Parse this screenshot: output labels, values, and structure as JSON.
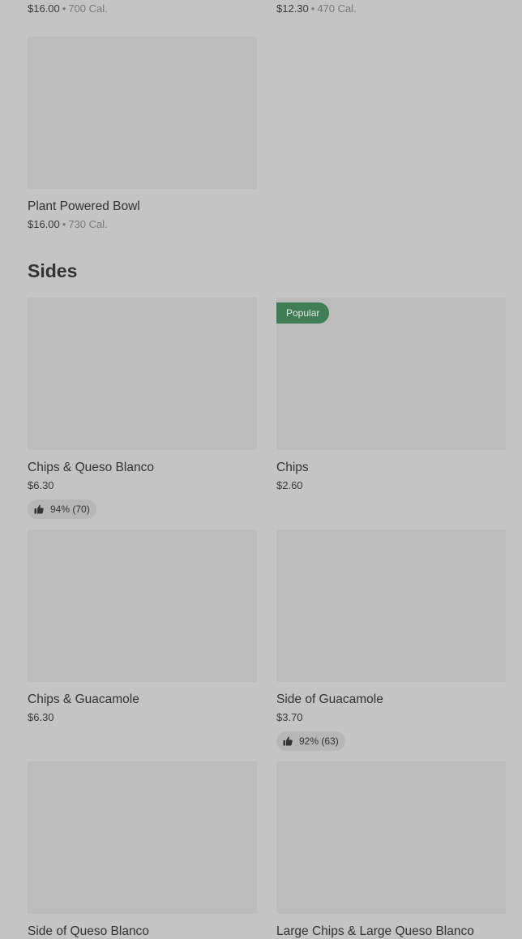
{
  "previous_section": {
    "items_top": [
      {
        "price": "$16.00",
        "calories": "700 Cal."
      },
      {
        "price": "$12.30",
        "calories": "470 Cal."
      }
    ],
    "item_plant": {
      "name": "Plant Powered Bowl",
      "price": "$16.00",
      "calories": "730 Cal."
    },
    "separator": "•"
  },
  "sides": {
    "title": "Sides",
    "items": [
      {
        "name": "Chips & Queso Blanco",
        "price": "$6.30",
        "rating": "94% (70)"
      },
      {
        "name": "Chips",
        "price": "$2.60",
        "badge": "Popular"
      },
      {
        "name": "Chips & Guacamole",
        "price": "$6.30"
      },
      {
        "name": "Side of Guacamole",
        "price": "$3.70",
        "rating": "92% (63)"
      },
      {
        "name": "Side of Queso Blanco"
      },
      {
        "name": "Large Chips & Large Queso Blanco"
      }
    ]
  },
  "colors": {
    "background": "#c4c4c4",
    "image_placeholder": "#bcbcbc",
    "popular_badge": "#3f7d55",
    "rating_pill": "#b7b7b7"
  },
  "icons": {
    "rating": "thumbs-up-icon"
  }
}
